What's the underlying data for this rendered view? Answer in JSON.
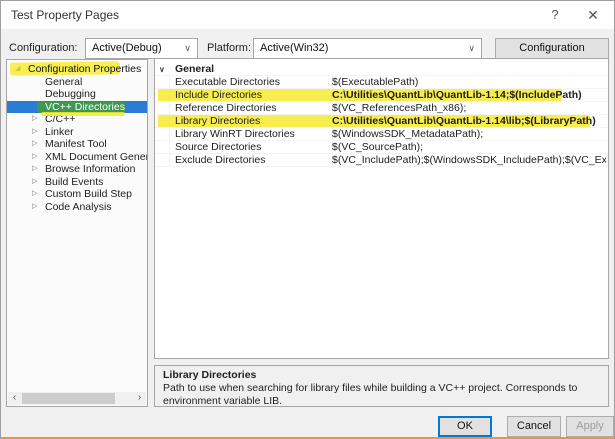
{
  "window": {
    "title": "Test Property Pages"
  },
  "icons": {
    "help": "?",
    "close": "✕",
    "expanded_triangle": "◢",
    "collapsed_arrow": "▷",
    "group_chevron": "∨",
    "combo_chevron": "∨",
    "scroll_left": "‹",
    "scroll_right": "›"
  },
  "toolbar": {
    "configuration_label": "Configuration:",
    "configuration_value": "Active(Debug)",
    "platform_label": "Platform:",
    "platform_value": "Active(Win32)",
    "config_manager_button": "Configuration Manager..."
  },
  "tree": {
    "root_label": "Configuration Properties",
    "items": [
      {
        "label": "General"
      },
      {
        "label": "Debugging"
      },
      {
        "label": "VC++ Directories"
      },
      {
        "label": "C/C++"
      },
      {
        "label": "Linker"
      },
      {
        "label": "Manifest Tool"
      },
      {
        "label": "XML Document Generator"
      },
      {
        "label": "Browse Information"
      },
      {
        "label": "Build Events"
      },
      {
        "label": "Custom Build Step"
      },
      {
        "label": "Code Analysis"
      }
    ]
  },
  "grid": {
    "group_header": "General",
    "rows": [
      {
        "name": "Executable Directories",
        "value": "$(ExecutablePath)"
      },
      {
        "name": "Include Directories",
        "value": "C:\\Utilities\\QuantLib\\QuantLib-1.14;$(IncludePath)"
      },
      {
        "name": "Reference Directories",
        "value": "$(VC_ReferencesPath_x86);"
      },
      {
        "name": "Library Directories",
        "value": "C:\\Utilities\\QuantLib\\QuantLib-1.14\\lib;$(LibraryPath)"
      },
      {
        "name": "Library WinRT Directories",
        "value": "$(WindowsSDK_MetadataPath);"
      },
      {
        "name": "Source Directories",
        "value": "$(VC_SourcePath);"
      },
      {
        "name": "Exclude Directories",
        "value": "$(VC_IncludePath);$(WindowsSDK_IncludePath);$(VC_ExecutablePa"
      }
    ]
  },
  "description": {
    "title": "Library Directories",
    "body": "Path to use when searching for library files while building a VC++ project.  Corresponds to environment variable LIB."
  },
  "buttons": {
    "ok": "OK",
    "cancel": "Cancel",
    "apply": "Apply"
  },
  "colors": {
    "selection_blue": "#2a7cd4",
    "highlight_yellow": "#f6ea30",
    "highlight_green": "#44a02c",
    "focus_blue": "#0078d7",
    "bottom_orange": "#e8954a"
  }
}
